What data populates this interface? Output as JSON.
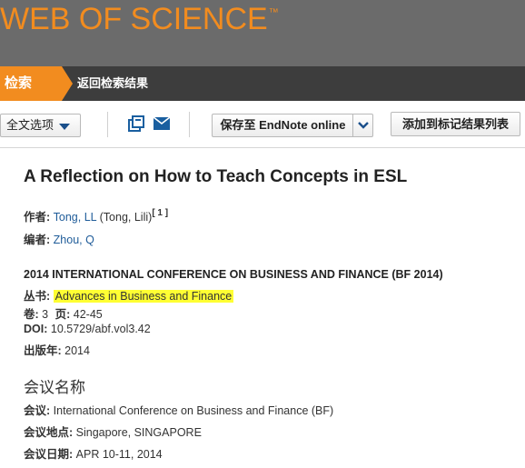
{
  "header": {
    "brand": "WEB OF SCIENCE",
    "brand_tm": "™"
  },
  "nav": {
    "tab": "检索",
    "back": "返回检索结果"
  },
  "toolbar": {
    "fulltext": "全文选项",
    "endnote": "保存至 EndNote online",
    "add_marked": "添加到标记结果列表"
  },
  "record": {
    "title": "A Reflection on How to Teach Concepts in ESL",
    "author_label": "作者:",
    "author_name": "Tong, LL",
    "author_full": "(Tong, Lili)",
    "author_ref": "[ 1 ]",
    "editor_label": "编者:",
    "editor_name": "Zhou, Q",
    "source": "2014 INTERNATIONAL CONFERENCE ON BUSINESS AND FINANCE (BF 2014)",
    "series_label": "丛书:",
    "series": "Advances in Business and Finance",
    "volume_label": "卷:",
    "volume": "3",
    "pages_label": "页:",
    "pages": "42-45",
    "doi_label": "DOI:",
    "doi": "10.5729/abf.vol3.42",
    "year_label": "出版年:",
    "year": "2014"
  },
  "conference": {
    "heading": "会议名称",
    "name_label": "会议:",
    "name": "International Conference on Business and Finance (BF)",
    "location_label": "会议地点:",
    "location": "Singapore, SINGAPORE",
    "date_label": "会议日期:",
    "date": "APR 10-11, 2014"
  },
  "colors": {
    "brand_orange": "#f28c1f",
    "banner": "#6b6b6b",
    "navbar": "#3d3d3d",
    "link": "#1f5c99",
    "highlight": "#ffff33"
  },
  "icons": [
    "print-icon",
    "email-icon",
    "chevron-down-icon",
    "caret-down-icon"
  ]
}
